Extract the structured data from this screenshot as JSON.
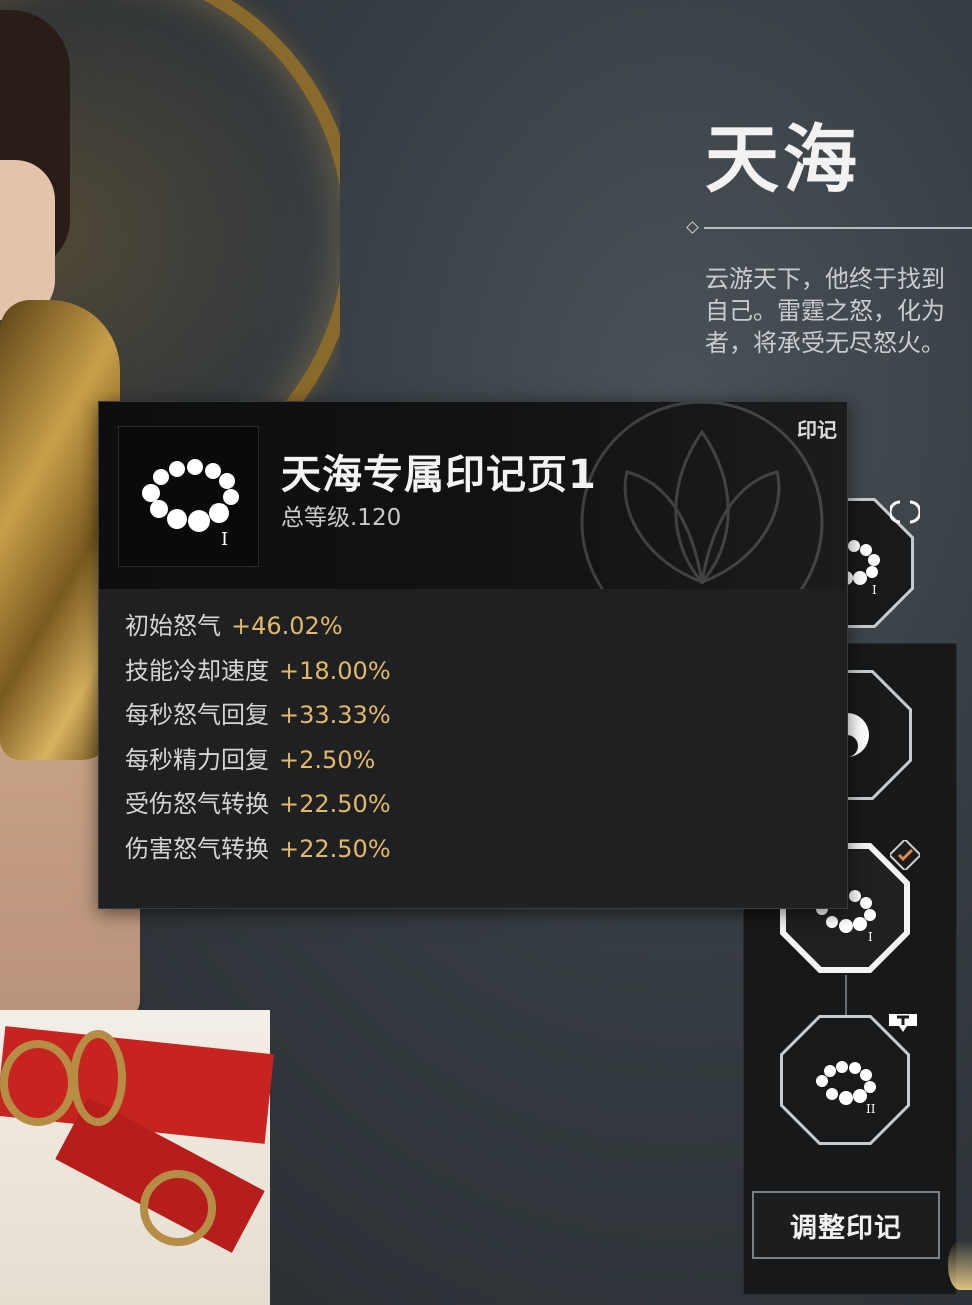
{
  "hero": {
    "name": "天海",
    "description_lines": [
      "云游天下，他终于找到",
      "自己。雷霆之怒，化为",
      "者，将承受无尽怒火。"
    ]
  },
  "tooltip": {
    "title": "天海专属印记页1",
    "level": "总等级.120",
    "tag": "印记",
    "icon_numeral": "I",
    "stats": [
      {
        "name": "初始怒气",
        "value": "+46.02%"
      },
      {
        "name": "技能冷却速度",
        "value": "+18.00%"
      },
      {
        "name": "每秒怒气回复",
        "value": "+33.33%"
      },
      {
        "name": "每秒精力回复",
        "value": "+2.50%"
      },
      {
        "name": "受伤怒气转换",
        "value": "+22.50%"
      },
      {
        "name": "伤害怒气转换",
        "value": "+22.50%"
      }
    ]
  },
  "seal_slots": [
    {
      "icon": "prayer-beads-icon",
      "numeral": "I",
      "state": "normal"
    },
    {
      "icon": "yin-yang-icon",
      "numeral": "",
      "state": "normal"
    },
    {
      "icon": "prayer-beads-icon",
      "numeral": "I",
      "state": "selected"
    },
    {
      "icon": "prayer-beads-icon",
      "numeral": "II",
      "state": "normal"
    }
  ],
  "adjust_button_label": "调整印记",
  "colors": {
    "stat_value": "#e2b86a",
    "check_accent": "#e2884a"
  }
}
